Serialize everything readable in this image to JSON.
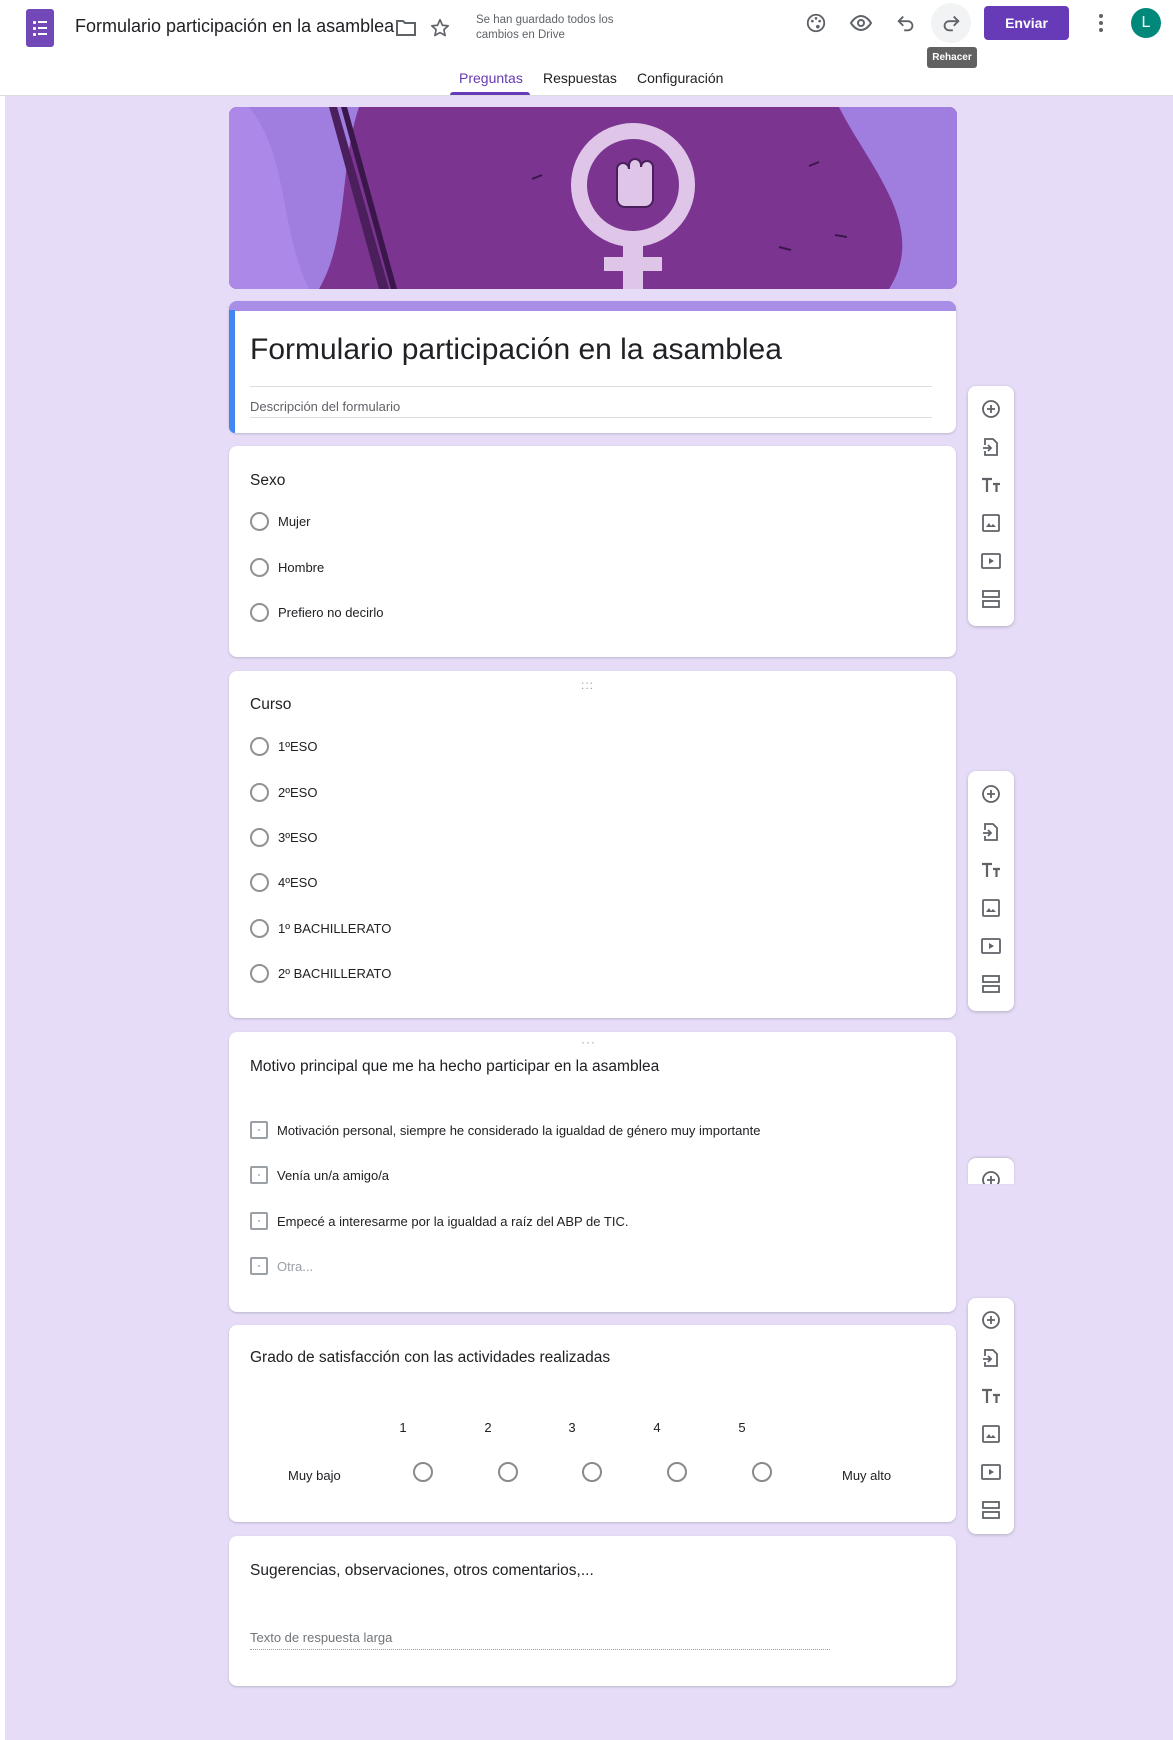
{
  "app": {
    "doc_title": "Formulario participación en la asamblea",
    "save_status": "Se han guardado todos los cambios en Drive",
    "send_label": "Enviar",
    "redo_tooltip": "Rehacer",
    "avatar_initial": "L",
    "accent_color": "#673ab7",
    "background_color": "#e6dcf8"
  },
  "tabs": [
    {
      "label": "Preguntas",
      "active": true
    },
    {
      "label": "Respuestas",
      "active": false
    },
    {
      "label": "Configuración",
      "active": false
    }
  ],
  "header": {
    "title": "Formulario participación en la asamblea",
    "description_placeholder": "Descripción del formulario"
  },
  "questions": [
    {
      "title": "Sexo",
      "type": "radio",
      "options": [
        "Mujer",
        "Hombre",
        "Prefiero no decirlo"
      ]
    },
    {
      "title": "Curso",
      "type": "radio",
      "options": [
        "1ºESO",
        "2ºESO",
        "3ºESO",
        "4ºESO",
        "1º BACHILLERATO",
        "2º BACHILLERATO"
      ]
    },
    {
      "title": "Motivo principal que me ha hecho participar en la asamblea",
      "type": "checkbox",
      "options": [
        "Motivación personal, siempre he considerado la igualdad de género muy importante",
        "Venía un/a amigo/a",
        "Empecé a interesarme por la igualdad a raíz del ABP de TIC.",
        "Otra..."
      ]
    },
    {
      "title": "Grado de satisfacción con las actividades realizadas",
      "type": "scale",
      "scale": [
        "1",
        "2",
        "3",
        "4",
        "5"
      ],
      "low_label": "Muy bajo",
      "high_label": "Muy alto"
    },
    {
      "title": "Sugerencias, observaciones, otros comentarios,...",
      "type": "paragraph",
      "placeholder": "Texto de respuesta larga"
    }
  ],
  "toolbar_icons": [
    "add-question-icon",
    "import-questions-icon",
    "add-title-icon",
    "add-image-icon",
    "add-video-icon",
    "add-section-icon"
  ],
  "drag_handle": ":::",
  "drag_handle_alt": "···"
}
